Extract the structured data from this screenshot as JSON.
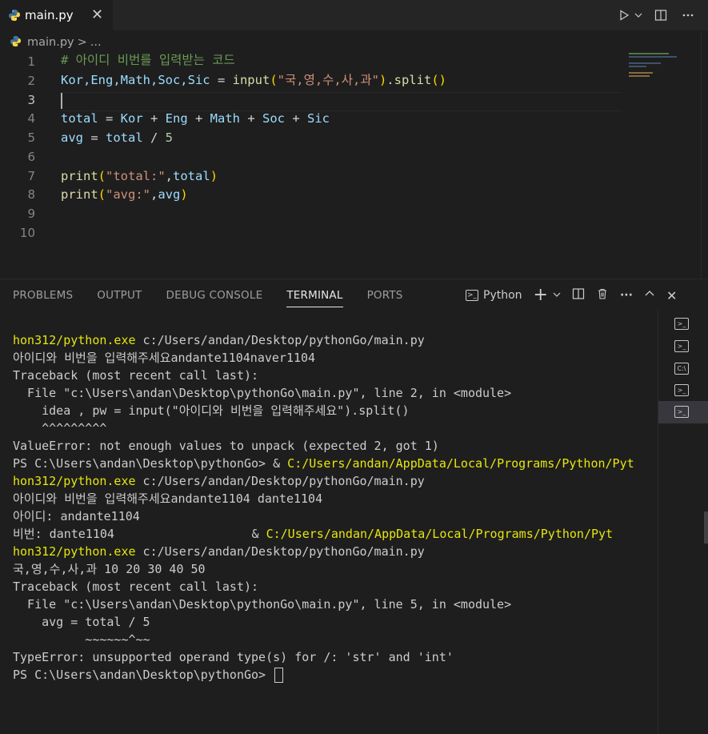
{
  "tab": {
    "filename": "main.py",
    "close": "✕"
  },
  "breadcrumb": {
    "file": "main.py",
    "sep": ">",
    "more": "..."
  },
  "editor": {
    "line_numbers": [
      "1",
      "2",
      "3",
      "4",
      "5",
      "6",
      "7",
      "8",
      "9",
      "10"
    ],
    "line1": "# 아이디 비번를 입력받는 코드",
    "line2": {
      "vars": "Kor,Eng,Math,Soc,Sic",
      "eq": " = ",
      "fn": "input",
      "p1": "(",
      "str": "\"국,영,수,사,과\"",
      "p2": ")",
      "dot": ".",
      "fn2": "split",
      "p3": "()"
    },
    "line4": {
      "total": "total",
      "eq": " = ",
      "a": "Kor",
      "p": " + ",
      "b": "Eng",
      "c": "Math",
      "d": "Soc",
      "e": "Sic"
    },
    "line5": {
      "avg": "avg",
      "eq": " = ",
      "total": "total",
      "div": " / ",
      "num": "5"
    },
    "line7": {
      "fn": "print",
      "p1": "(",
      "str": "\"total:\"",
      "comma": ",",
      "arg": "total",
      "p2": ")"
    },
    "line8": {
      "fn": "print",
      "p1": "(",
      "str": "\"avg:\"",
      "comma": ",",
      "arg": "avg",
      "p2": ")"
    }
  },
  "panel": {
    "tabs": [
      "PROBLEMS",
      "OUTPUT",
      "DEBUG CONSOLE",
      "TERMINAL",
      "PORTS"
    ],
    "active_tab": "TERMINAL",
    "terminal_name": "Python",
    "actions": {
      "add": "+",
      "chevron": "⌄",
      "split": "split",
      "trash": "trash",
      "more": "···",
      "maximize": "^",
      "close": "✕"
    }
  },
  "terminal": {
    "l1a": "hon312/python.exe",
    "l1b": " c:/Users/andan/Desktop/pythonGo/main.py",
    "l2": "아이디와 비번을 입력해주세요andante1104naver1104",
    "l3": "Traceback (most recent call last):",
    "l4": "  File \"c:\\Users\\andan\\Desktop\\pythonGo\\main.py\", line 2, in <module>",
    "l5": "    idea , pw = input(\"아이디와 비번을 입력해주세요\").split()",
    "l6": "    ^^^^^^^^^",
    "l7": "ValueError: not enough values to unpack (expected 2, got 1)",
    "l8a": "PS C:\\Users\\andan\\Desktop\\pythonGo> & ",
    "l8b": "C:/Users/andan/AppData/Local/Programs/Python/Pyt",
    "l9a": "hon312/python.exe",
    "l9b": " c:/Users/andan/Desktop/pythonGo/main.py",
    "l10": "아이디와 비번을 입력해주세요andante1104 dante1104",
    "l11": "아이디: andante1104",
    "l12a": "비번: dante1104                   & ",
    "l12b": "C:/Users/andan/AppData/Local/Programs/Python/Pyt",
    "l13a": "hon312/python.exe",
    "l13b": " c:/Users/andan/Desktop/pythonGo/main.py",
    "l14": "국,영,수,사,과 10 20 30 40 50",
    "l15": "Traceback (most recent call last):",
    "l16": "  File \"c:\\Users\\andan\\Desktop\\pythonGo\\main.py\", line 5, in <module>",
    "l17": "    avg = total / 5",
    "l18": "          ~~~~~~^~~",
    "l19": "TypeError: unsupported operand type(s) for /: 'str' and 'int'",
    "l20": "PS C:\\Users\\andan\\Desktop\\pythonGo> "
  },
  "colors": {
    "background": "#1e1e1e",
    "accent_yellow": "#e5e510",
    "comment": "#6a9955",
    "variable": "#9cdcfe",
    "function": "#dcdcaa",
    "string": "#ce9178"
  }
}
